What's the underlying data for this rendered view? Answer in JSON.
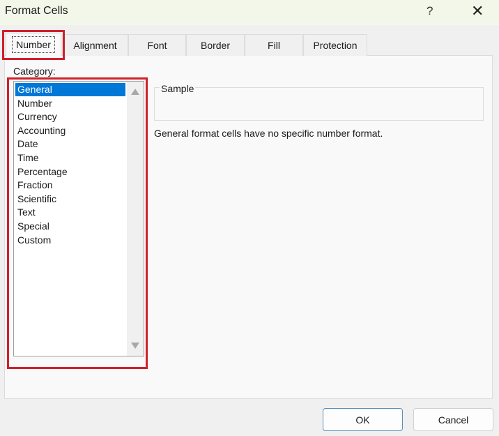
{
  "window": {
    "title": "Format Cells",
    "help_label": "?",
    "close_label": "✕"
  },
  "tabs": [
    {
      "label": "Number",
      "active": true
    },
    {
      "label": "Alignment"
    },
    {
      "label": "Font"
    },
    {
      "label": "Border"
    },
    {
      "label": "Fill"
    },
    {
      "label": "Protection"
    }
  ],
  "category": {
    "label": "Category:",
    "selected": "General",
    "items": [
      "General",
      "Number",
      "Currency",
      "Accounting",
      "Date",
      "Time",
      "Percentage",
      "Fraction",
      "Scientific",
      "Text",
      "Special",
      "Custom"
    ]
  },
  "sample": {
    "label": "Sample",
    "value": ""
  },
  "description": "General format cells have no specific number format.",
  "buttons": {
    "ok": "OK",
    "cancel": "Cancel"
  },
  "colors": {
    "highlight_box": "#d0202a",
    "selection": "#0078d7"
  }
}
